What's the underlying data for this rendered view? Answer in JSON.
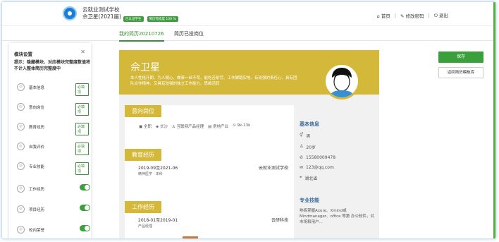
{
  "header": {
    "school": "云就业测试学校",
    "user": "佘卫星(2021届)",
    "badges": [
      "已认证学生",
      "简历完成度 100 %"
    ],
    "nav": [
      {
        "icon": "home-icon",
        "label": "首页"
      },
      {
        "icon": "edit-icon",
        "label": "修改密码"
      },
      {
        "icon": "power-icon",
        "label": "退出"
      }
    ]
  },
  "tabs": [
    {
      "label": "我的简历20210726",
      "active": true
    },
    {
      "label": "简历已投岗位",
      "active": false
    }
  ],
  "left_panel": {
    "title": "模块设置",
    "tip": "提示：隐藏模块、对应模块完整度数值将不计入整体简历完整度中",
    "modules": [
      {
        "label": "基本信息",
        "control": "必填项"
      },
      {
        "label": "意向岗位",
        "control": "必填项"
      },
      {
        "label": "教育经历",
        "control": "必填项"
      },
      {
        "label": "自我评价",
        "control": "必填项"
      },
      {
        "label": "专业技能",
        "control": "必填项"
      },
      {
        "label": "工作经历",
        "control": "toggle",
        "on": true
      },
      {
        "label": "项目经历",
        "control": "toggle",
        "on": true
      },
      {
        "label": "校内荣誉",
        "control": "toggle",
        "on": true
      }
    ]
  },
  "resume": {
    "name": "佘卫星",
    "intro": "本人性格开朗、为人随心、做事一丝不苟、能吃苦耐劳、工作脚踏实地、有较强的责任心、具有团队合作精神、又具有较强的独立工作能力、思维活跃",
    "intent": {
      "title": "意向岗位",
      "type": "全职",
      "city": "长沙",
      "position": "互联网产品经理",
      "industry": "房地产业",
      "salary": "9k-13k"
    },
    "education": {
      "title": "教育经历",
      "period": "2019-09至2021-06",
      "school": "云就业测试学校",
      "major": "精神医学",
      "degree": "本科"
    },
    "work": {
      "title": "工作经历",
      "period": "2018-01至2019-01",
      "company": "云研科技",
      "role": "产品经理"
    },
    "basic": {
      "title": "基本信息",
      "gender": "男",
      "age": "20岁",
      "phone": "15580009478",
      "email": "123@qq.com",
      "region": "湖北省"
    },
    "skills": {
      "title": "专业技能",
      "text": "熟练掌握Axure、Xmind或Mindmanager、office 等第 办公软件，对市场和用户..."
    }
  },
  "buttons": {
    "save": "保存",
    "back": "返回简历模板库"
  },
  "colors": {
    "accent": "#3ba03b",
    "resume_gold": "#d4b83a"
  }
}
